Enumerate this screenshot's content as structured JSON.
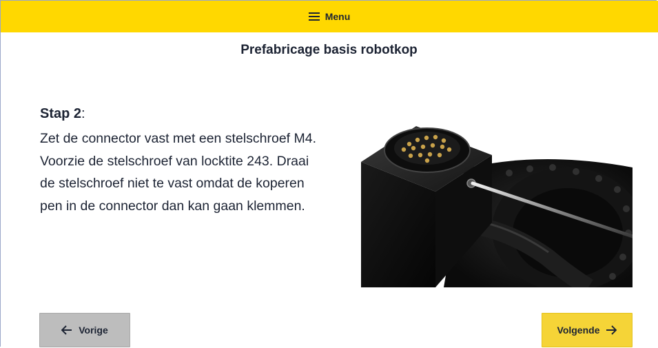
{
  "header": {
    "menu_label": "Menu",
    "menu_icon": "hamburger-icon",
    "background_color": "#ffd800"
  },
  "page": {
    "title": "Prefabricage basis robotkop"
  },
  "step": {
    "label": "Stap 2",
    "label_suffix": ":",
    "lines": [
      "Zet de connector vast met een stelschroef M4.",
      "Voorzie de stelschroef van locktite 243. Draai",
      "de stelschroef niet te vast omdat de koperen",
      "pen in de connector dan kan gaan klemmen."
    ]
  },
  "navigation": {
    "prev_label": "Vorige",
    "prev_icon": "arrow-left-icon",
    "next_label": "Volgende",
    "next_icon": "arrow-right-icon",
    "prev_color": "#bdbdbd",
    "next_color": "#f5d437"
  }
}
